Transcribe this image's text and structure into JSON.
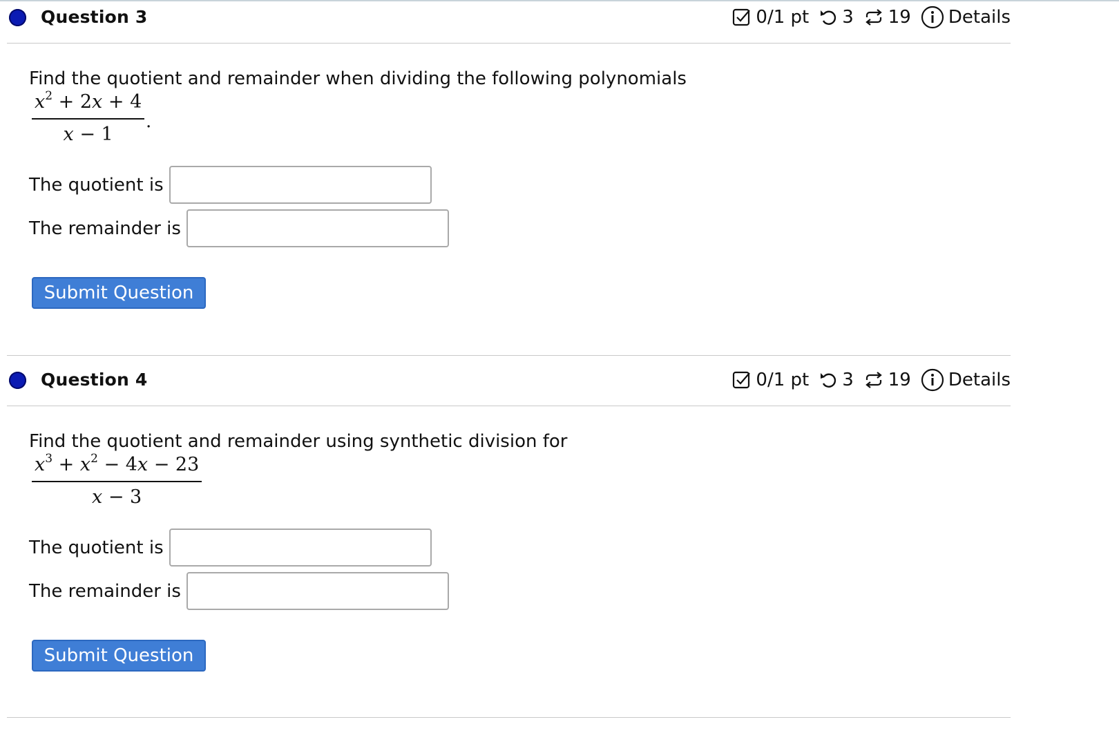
{
  "q3": {
    "title": "Question 3",
    "points": "0/1 pt",
    "retries": "3",
    "attempts": "19",
    "details": "Details",
    "prompt": "Find the quotient and remainder when dividing the following polynomials",
    "numerator": "x² + 2x + 4",
    "denominator": "x − 1",
    "quotient_label": "The quotient is",
    "remainder_label": "The remainder is",
    "quotient_value": "",
    "remainder_value": "",
    "submit_label": "Submit Question"
  },
  "q4": {
    "title": "Question 4",
    "points": "0/1 pt",
    "retries": "3",
    "attempts": "19",
    "details": "Details",
    "prompt": "Find the quotient and remainder using synthetic division for",
    "numerator": "x³ + x² − 4x − 23",
    "denominator": "x − 3",
    "quotient_label": "The quotient is",
    "remainder_label": "The remainder is",
    "quotient_value": "",
    "remainder_value": "",
    "submit_label": "Submit Question"
  },
  "icons": {
    "status": "filled-circle-icon",
    "points": "checkbox-pencil-icon",
    "retry": "undo-arrow-icon",
    "attempts": "repeat-arrows-icon",
    "details": "info-icon"
  },
  "colors": {
    "status_dot": "#0b1bb3",
    "submit_bg": "#3f7ed6"
  }
}
